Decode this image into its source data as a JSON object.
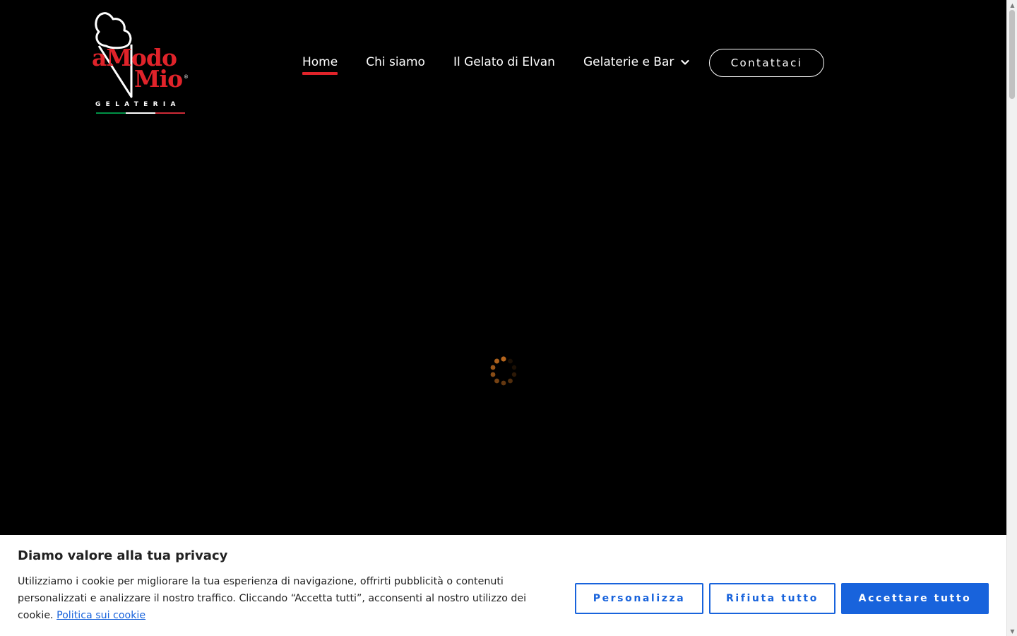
{
  "logo": {
    "brand_line1": "aModo",
    "brand_line2": "Mio",
    "registered": "®",
    "subtitle": "GELATERIA",
    "flag_colors": [
      "#009246",
      "#ffffff",
      "#ce2b37"
    ],
    "accent": "#e0232a"
  },
  "nav": {
    "items": [
      {
        "label": "Home",
        "active": true
      },
      {
        "label": "Chi siamo",
        "active": false
      },
      {
        "label": "Il Gelato di Elvan",
        "active": false
      },
      {
        "label": "Gelaterie e Bar",
        "active": false,
        "has_dropdown": true,
        "icon": "chevron-down-icon"
      }
    ],
    "cta_label": "Contattaci"
  },
  "loader": {
    "icon": "loading-spinner-icon",
    "color": "#b5651d"
  },
  "cookie_banner": {
    "title": "Diamo valore alla tua privacy",
    "text": "Utilizziamo i cookie per migliorare la tua esperienza di navigazione, offrirti pubblicità o contenuti personalizzati e analizzare il nostro traffico. Cliccando “Accetta tutti”, acconsenti al nostro utilizzo dei cookie.",
    "policy_link": "Politica sui cookie",
    "buttons": {
      "customize": "Personalizza",
      "reject": "Rifiuta tutto",
      "accept": "Accettare tutto"
    },
    "accent": "#1863dc"
  },
  "colors": {
    "background": "#000000",
    "nav_text": "#ffffff",
    "active_underline": "#e0232a"
  }
}
